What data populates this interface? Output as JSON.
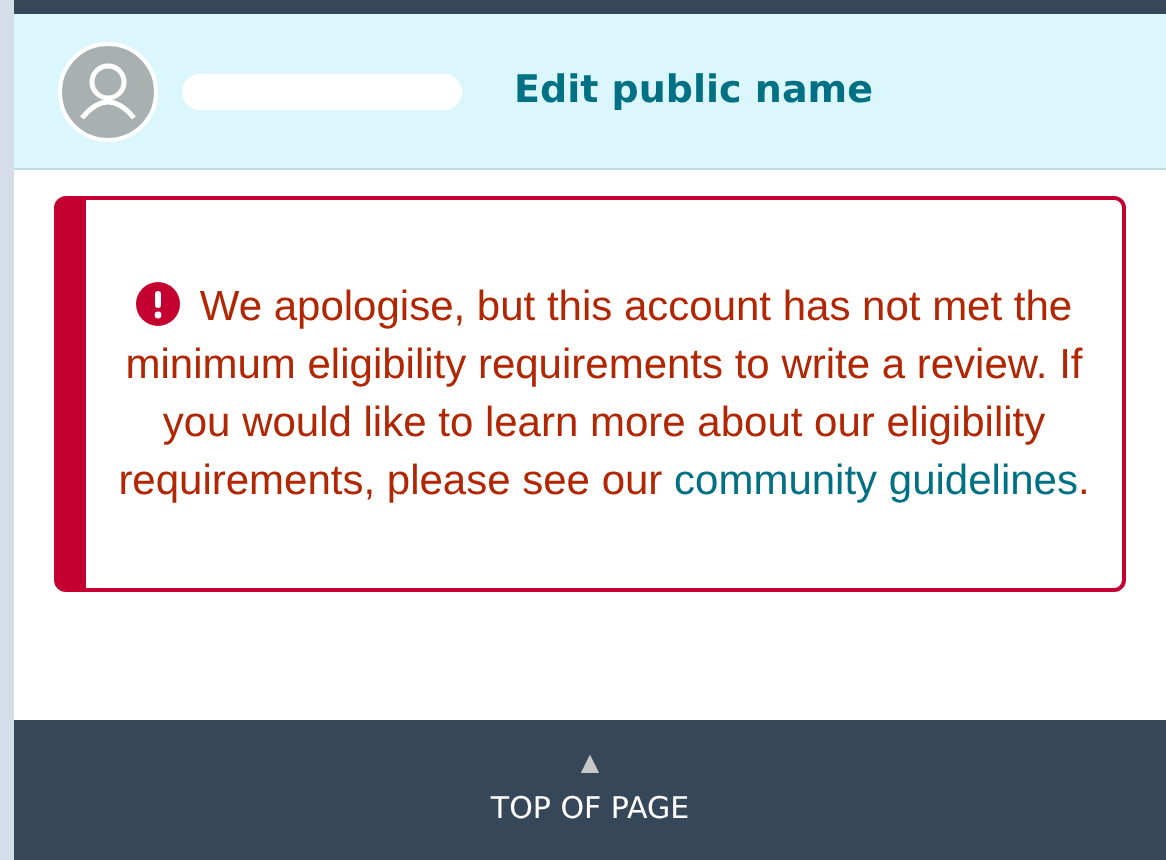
{
  "header": {
    "title": "Edit public name"
  },
  "alert": {
    "message": "We apologise, but this account has not met the minimum eligibility requirements to write a review. If you would like to learn more about our eligibility requirements, please see our",
    "link": "community guidelines",
    "after": "."
  },
  "footer": {
    "arrow": "▲",
    "label": "TOP OF PAGE"
  }
}
